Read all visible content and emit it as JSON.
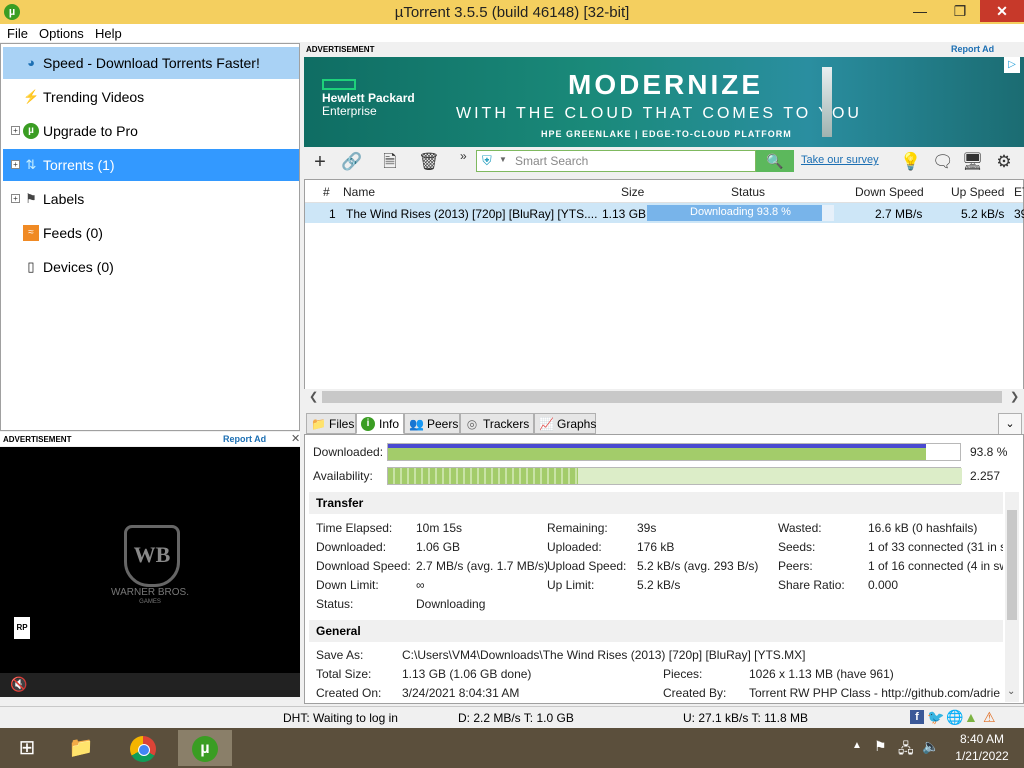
{
  "window": {
    "title": "µTorrent 3.5.5  (build 46148) [32-bit]",
    "logo": "µ"
  },
  "menu": [
    "File",
    "Options",
    "Help"
  ],
  "sidebar": {
    "items": [
      {
        "label": "Speed - Download Torrents Faster!",
        "icon": "speed-icon"
      },
      {
        "label": "Trending Videos",
        "icon": "bolt-icon"
      },
      {
        "label": "Upgrade to Pro",
        "icon": "utorrent-icon"
      },
      {
        "label": "Torrents (1)",
        "icon": "torrents-icon"
      },
      {
        "label": "Labels",
        "icon": "tag-icon"
      },
      {
        "label": "Feeds (0)",
        "icon": "rss-icon"
      },
      {
        "label": "Devices (0)",
        "icon": "device-icon"
      }
    ]
  },
  "left_ad": {
    "head": "ADVERTISEMENT",
    "report": "Report Ad",
    "brand_line1": "WARNER BROS.",
    "brand_line2": "GAMES",
    "wb": "WB",
    "rating": "RP",
    "mute_icon": "mute-icon"
  },
  "top_ad": {
    "head": "ADVERTISEMENT",
    "report": "Report Ad",
    "hpe_line1": "Hewlett Packard",
    "hpe_line2": "Enterprise",
    "headline": "MODERNIZE",
    "subline": "WITH THE CLOUD THAT COMES TO YOU",
    "tagline": "HPE GREENLAKE | EDGE-TO-CLOUD PLATFORM"
  },
  "toolbar": {
    "search_placeholder": "Smart Search",
    "survey": "Take our survey",
    "more": "»"
  },
  "list": {
    "headers": [
      "#",
      "Name",
      "Size",
      "Status",
      "Down Speed",
      "Up Speed",
      "ET"
    ],
    "rows": [
      {
        "num": "1",
        "name": "The Wind Rises (2013) [720p] [BluRay] [YTS....",
        "size": "1.13 GB",
        "status": "Downloading 93.8 %",
        "progress": 0.938,
        "down": "2.7 MB/s",
        "up": "5.2 kB/s",
        "eta": "39"
      }
    ]
  },
  "tabs": [
    "Files",
    "Info",
    "Peers",
    "Trackers",
    "Graphs"
  ],
  "info": {
    "downloaded_label": "Downloaded:",
    "downloaded_value": "93.8 %",
    "downloaded_fraction": 0.938,
    "availability_label": "Availability:",
    "availability_value": "2.257",
    "transfer_title": "Transfer",
    "transfer": [
      [
        "Time Elapsed:",
        "10m 15s",
        "Remaining:",
        "39s",
        "Wasted:",
        "16.6 kB (0 hashfails)"
      ],
      [
        "Downloaded:",
        "1.06 GB",
        "Uploaded:",
        "176 kB",
        "Seeds:",
        "1 of 33 connected (31 in s"
      ],
      [
        "Download Speed:",
        "2.7 MB/s (avg. 1.7 MB/s)",
        "Upload Speed:",
        "5.2 kB/s (avg. 293 B/s)",
        "Peers:",
        "1 of 16 connected (4 in sw"
      ],
      [
        "Down Limit:",
        "∞",
        "Up Limit:",
        "5.2 kB/s",
        "Share Ratio:",
        "0.000"
      ],
      [
        "Status:",
        "Downloading",
        "",
        "",
        "",
        ""
      ]
    ],
    "general_title": "General",
    "save_as_label": "Save As:",
    "save_as": "C:\\Users\\VM4\\Downloads\\The Wind Rises (2013) [720p] [BluRay] [YTS.MX]",
    "total_size_label": "Total Size:",
    "total_size": "1.13 GB (1.06 GB done)",
    "pieces_label": "Pieces:",
    "pieces": "1026 x 1.13 MB (have 961)",
    "created_on_label": "Created On:",
    "created_on": "3/24/2021 8:04:31 AM",
    "created_by_label": "Created By:",
    "created_by": "Torrent RW PHP Class - http://github.com/adrie"
  },
  "status": {
    "dht": "DHT: Waiting to log in",
    "down": "D: 2.2 MB/s T: 1.0 GB",
    "up": "U: 27.1 kB/s T: 11.8 MB"
  },
  "taskbar": {
    "time": "8:40 AM",
    "date": "1/21/2022"
  }
}
